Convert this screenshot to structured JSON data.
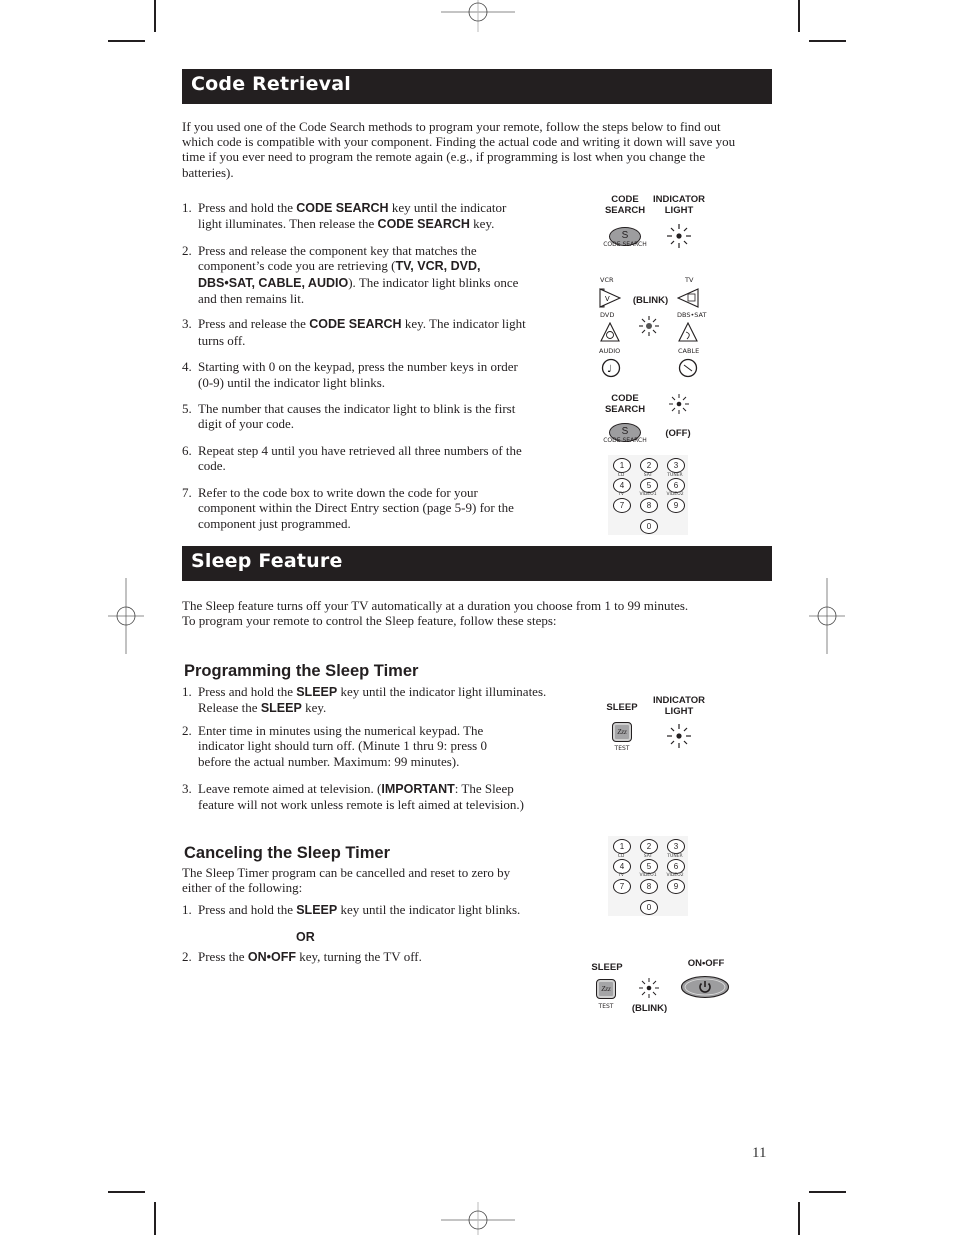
{
  "page_number": "11",
  "code_retrieval": {
    "title": "Code Retrieval",
    "intro": "If you used one of the Code Search methods to program your remote, follow the steps below to find out which code is compatible with your component. Finding the actual code and writing it down will save you time if you ever need to program the remote again (e.g., if programming is lost when you change the batteries).",
    "steps": [
      {
        "num": "1.",
        "parts": [
          "Press and hold the ",
          "CODE SEARCH",
          " key until the indicator light illuminates. Then release the ",
          "CODE SEARCH",
          " key."
        ]
      },
      {
        "num": "2.",
        "parts": [
          "Press and release the component key that matches the component’s code you are retrieving (",
          "TV, VCR, DVD, DBS•SAT, CABLE, AUDIO",
          "). The indicator light blinks once and then remains lit."
        ]
      },
      {
        "num": "3.",
        "parts": [
          "Press and release the ",
          "CODE SEARCH",
          " key. The indicator light turns off."
        ]
      },
      {
        "num": "4.",
        "parts": [
          "Starting with 0 on the keypad, press the number keys in order (0-9) until the indicator light blinks."
        ]
      },
      {
        "num": "5.",
        "parts": [
          "The number that causes the indicator light to blink is the first digit of your code."
        ]
      },
      {
        "num": "6.",
        "parts": [
          "Repeat step 4 until you have retrieved all three numbers of the code."
        ]
      },
      {
        "num": "7.",
        "parts": [
          "Refer to the code box to write down the code for your component within the Direct Entry section (page 5-9) for the component just programmed."
        ]
      }
    ],
    "illustration": {
      "code_search_label": "CODE SEARCH",
      "indicator_light_label": "INDICATOR LIGHT",
      "s_key": "S",
      "s_key_caption": "CODE SEARCH",
      "blink_label": "(BLINK)",
      "off_label": "(OFF)",
      "components": {
        "vcr": "VCR",
        "tv": "TV",
        "dvd": "DVD",
        "dbs_sat": "DBS•SAT",
        "audio": "AUDIO",
        "cable": "CABLE"
      }
    }
  },
  "keypad": {
    "keys": [
      "1",
      "2",
      "3",
      "4",
      "5",
      "6",
      "7",
      "8",
      "9",
      "0"
    ],
    "sublabels": [
      "CD",
      "SAT",
      "TUNER",
      "TV",
      "VIDEO1",
      "VIDEO2"
    ]
  },
  "sleep_feature": {
    "title": "Sleep Feature",
    "intro_line1": "The Sleep feature turns off your TV automatically at a duration you choose from 1 to 99 minutes.",
    "intro_line2": "To program your remote to control the Sleep feature, follow these steps:",
    "programming": {
      "heading": "Programming the Sleep Timer",
      "steps": [
        {
          "num": "1.",
          "parts": [
            "Press and hold the ",
            "SLEEP",
            " key until the indicator light illuminates. Release the ",
            "SLEEP",
            " key."
          ]
        },
        {
          "num": "2.",
          "parts": [
            "Enter time in minutes using the numerical keypad. The indicator light should turn off. (Minute 1 thru 9: press 0 before the actual number. Maximum: 99 minutes)."
          ]
        },
        {
          "num": "3.",
          "parts": [
            "Leave remote aimed at television. (",
            "IMPORTANT",
            ": The Sleep feature will not work unless remote is left aimed at television.)"
          ]
        }
      ],
      "sleep_label": "SLEEP",
      "indicator_light_label": "INDICATOR LIGHT",
      "sleep_key": "Zzz",
      "sleep_key_caption": "TEST"
    },
    "canceling": {
      "heading": "Canceling the Sleep Timer",
      "intro": "The Sleep Timer program can be cancelled and reset to zero by either of the following:",
      "step1": {
        "num": "1.",
        "parts": [
          "Press and hold the ",
          "SLEEP",
          " key until the indicator light blinks."
        ]
      },
      "or_label": "OR",
      "step2": {
        "num": "2.",
        "parts": [
          "Press the ",
          "ON•OFF",
          " key, turning the TV off."
        ]
      },
      "sleep_label": "SLEEP",
      "onoff_label": "ON•OFF",
      "blink_label": "(BLINK)",
      "sleep_key": "Zzz",
      "sleep_key_caption": "TEST"
    }
  }
}
